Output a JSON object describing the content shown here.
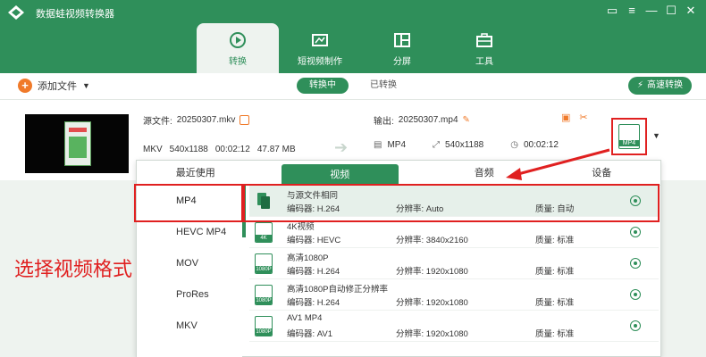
{
  "app": {
    "title": "数据蛙视频转换器"
  },
  "tabs": [
    {
      "label": "转换",
      "icon": "convert-icon"
    },
    {
      "label": "短视频制作",
      "icon": "video-icon"
    },
    {
      "label": "分屏",
      "icon": "split-icon"
    },
    {
      "label": "工具",
      "icon": "toolbox-icon"
    }
  ],
  "toolbar": {
    "add_file": "添加文件",
    "converting": "转换中",
    "converted": "已转换",
    "fast_convert": "高速转换"
  },
  "file": {
    "src_label": "源文件:",
    "src_name": "20250307.mkv",
    "src_format": "MKV",
    "src_resolution": "540x1188",
    "src_duration": "00:02:12",
    "src_size": "47.87 MB",
    "out_label": "输出:",
    "out_name": "20250307.mp4",
    "out_format": "MP4",
    "out_resolution": "540x1188",
    "out_duration": "00:02:12",
    "format_badge": "MP4"
  },
  "panel": {
    "tabs": [
      "最近使用",
      "视频",
      "音频",
      "设备"
    ],
    "formats": [
      "MP4",
      "HEVC MP4",
      "MOV",
      "ProRes",
      "MKV"
    ],
    "labels": {
      "encoder": "编码器:",
      "resolution": "分辨率:",
      "quality": "质量:"
    },
    "presets": [
      {
        "name": "与源文件相同",
        "encoder": "H.264",
        "resolution": "Auto",
        "quality": "自动",
        "badge": ""
      },
      {
        "name": "4K视频",
        "encoder": "HEVC",
        "resolution": "3840x2160",
        "quality": "标准",
        "badge": "4K"
      },
      {
        "name": "高清1080P",
        "encoder": "H.264",
        "resolution": "1920x1080",
        "quality": "标准",
        "badge": "1080P"
      },
      {
        "name": "高清1080P自动修正分辨率",
        "encoder": "H.264",
        "resolution": "1920x1080",
        "quality": "标准",
        "badge": "1080P"
      },
      {
        "name": "AV1 MP4",
        "encoder": "AV1",
        "resolution": "1920x1080",
        "quality": "标准",
        "badge": "1080P"
      }
    ]
  },
  "annotation": "选择视频格式",
  "colors": {
    "brand": "#2f8f5a",
    "accent": "#f07a2a",
    "highlight": "#e02020"
  }
}
